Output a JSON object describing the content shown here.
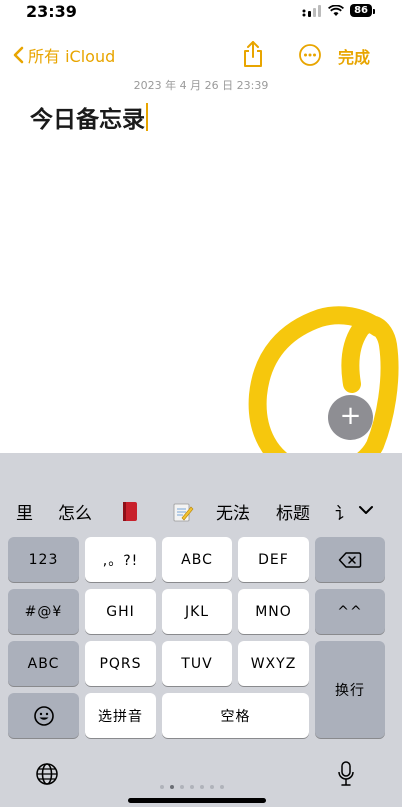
{
  "status": {
    "time": "23:39",
    "battery": "86"
  },
  "nav": {
    "back_label": "所有 iCloud",
    "done_label": "完成"
  },
  "note": {
    "date": "2023 年 4 月 26 日 23:39",
    "title": "今日备忘录"
  },
  "plus_button": {
    "label": "+"
  },
  "candidates": [
    "里",
    "怎么",
    "无法",
    "标题",
    "讠"
  ],
  "keys": {
    "row1": [
      "123",
      ",。?!",
      "ABC",
      "DEF"
    ],
    "row2": [
      "#@¥",
      "GHI",
      "JKL",
      "MNO",
      "^^"
    ],
    "row3": [
      "ABC",
      "PQRS",
      "TUV",
      "WXYZ"
    ],
    "return_label": "换行",
    "row4": [
      "选拼音",
      "空格"
    ]
  },
  "icons": {
    "back": "chevron-left-icon",
    "share": "share-icon",
    "more": "ellipsis-circle-icon",
    "delete": "delete-backward-icon",
    "emoji": "emoji-icon",
    "globe": "globe-icon",
    "mic": "microphone-icon",
    "expand": "chevron-down-icon"
  },
  "colors": {
    "accent": "#E8A500",
    "scribble": "#F5C400",
    "keyboard_bg": "#D1D3D9"
  }
}
